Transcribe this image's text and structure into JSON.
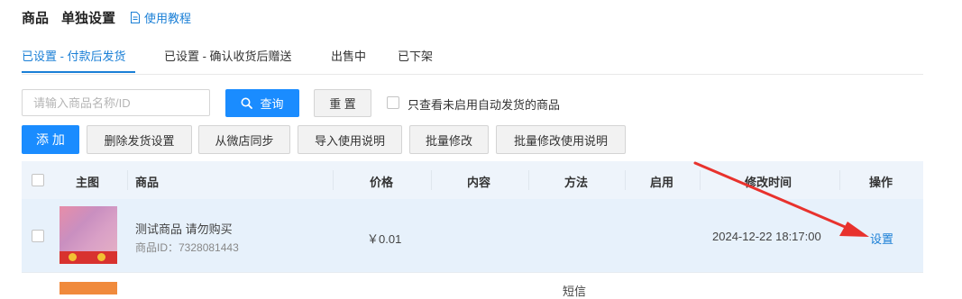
{
  "header": {
    "title_part1": "商品",
    "title_part2": "单独设置",
    "tutorial_link": "使用教程",
    "tutorial_icon": "document-icon"
  },
  "tabs": [
    {
      "label": "已设置 - 付款后发货",
      "active": true
    },
    {
      "label": "已设置 - 确认收货后赠送",
      "active": false
    },
    {
      "label": "出售中",
      "active": false
    },
    {
      "label": "已下架",
      "active": false
    }
  ],
  "toolbar": {
    "search_placeholder": "请输入商品名称/ID",
    "search_button": "查询",
    "search_icon": "search-icon",
    "reset_button": "重 置",
    "filter_label": "只查看未启用自动发货的商品",
    "add_button": "添 加",
    "delete_button": "删除发货设置",
    "sync_button": "从微店同步",
    "import_button": "导入使用说明",
    "batch_edit_button": "批量修改",
    "batch_edit_desc_button": "批量修改使用说明"
  },
  "table": {
    "columns": [
      "主图",
      "商品",
      "价格",
      "内容",
      "方法",
      "启用",
      "修改时间",
      "操作"
    ],
    "rows": [
      {
        "product_name": "测试商品 请勿购买",
        "product_id": "商品ID：7328081443",
        "price": "￥0.01",
        "content": "",
        "method": "",
        "enabled": "",
        "modified_time": "2024-12-22 18:17:00",
        "action": "设置"
      },
      {
        "partial_method": "短信"
      }
    ]
  },
  "colors": {
    "accent": "#1a8cff",
    "link": "#1a7fd6",
    "header_bg": "#eef4fb",
    "row_highlight": "#e7f1fb",
    "annotation_arrow": "#e8322d"
  }
}
